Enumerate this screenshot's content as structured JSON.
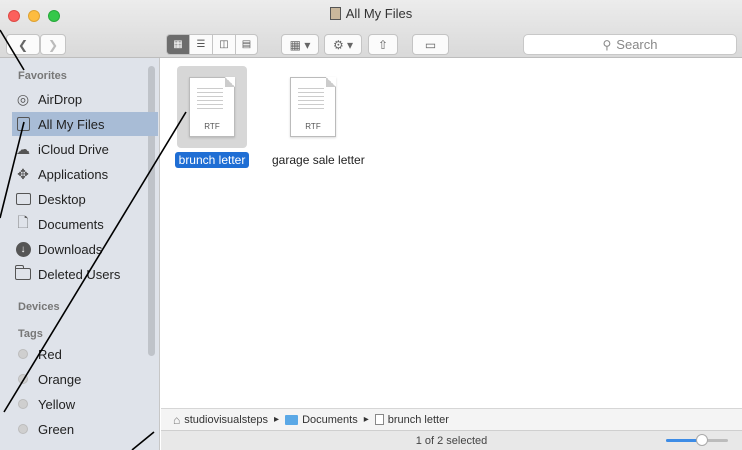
{
  "window": {
    "title": "All My Files"
  },
  "toolbar": {
    "search_placeholder": "Search",
    "view_buttons": [
      "icon-view",
      "list-view",
      "column-view",
      "cover-flow-view"
    ]
  },
  "sidebar": {
    "favorites_header": "Favorites",
    "favorites": [
      {
        "label": "AirDrop",
        "icon": "airdrop-icon"
      },
      {
        "label": "All My Files",
        "icon": "all-files-icon",
        "selected": true
      },
      {
        "label": "iCloud Drive",
        "icon": "cloud-icon"
      },
      {
        "label": "Applications",
        "icon": "applications-icon"
      },
      {
        "label": "Desktop",
        "icon": "desktop-icon"
      },
      {
        "label": "Documents",
        "icon": "documents-icon"
      },
      {
        "label": "Downloads",
        "icon": "downloads-icon"
      },
      {
        "label": "Deleted Users",
        "icon": "folder-icon"
      }
    ],
    "devices_header": "Devices",
    "tags_header": "Tags",
    "tags": [
      {
        "label": "Red"
      },
      {
        "label": "Orange"
      },
      {
        "label": "Yellow"
      },
      {
        "label": "Green"
      }
    ]
  },
  "files": [
    {
      "name": "brunch letter",
      "ext": "RTF",
      "selected": true
    },
    {
      "name": "garage sale letter",
      "ext": "RTF",
      "selected": false
    }
  ],
  "pathbar": {
    "items": [
      "studiovisualsteps",
      "Documents",
      "brunch letter"
    ]
  },
  "status": {
    "selection_text": "1 of 2 selected",
    "icon_size_level": 0.6
  },
  "colors": {
    "selection_blue": "#1f6ed4",
    "sidebar_selected": "#a8bcd6",
    "background_note": "#fdf6c4"
  }
}
